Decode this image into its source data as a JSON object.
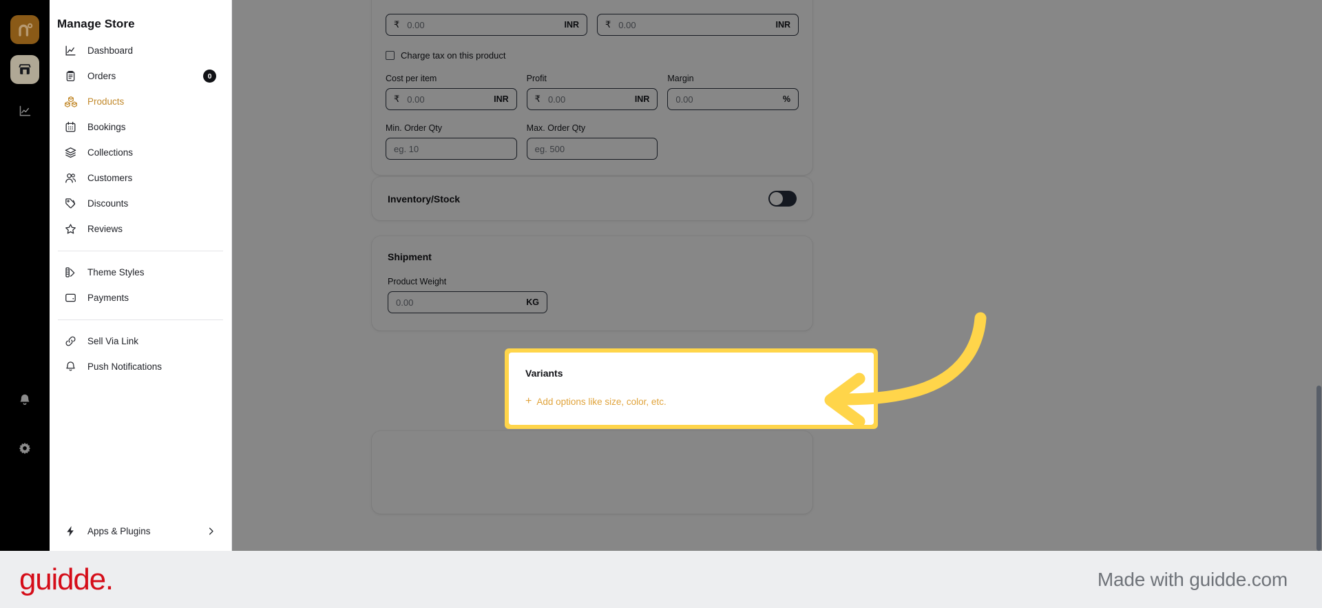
{
  "sidebar": {
    "title": "Manage Store",
    "items": [
      {
        "label": "Dashboard",
        "icon": "chart-line-icon",
        "active": false,
        "badge": null
      },
      {
        "label": "Orders",
        "icon": "clipboard-icon",
        "active": false,
        "badge": "0"
      },
      {
        "label": "Products",
        "icon": "boxes-icon",
        "active": true,
        "badge": null
      },
      {
        "label": "Bookings",
        "icon": "calendar-icon",
        "active": false,
        "badge": null
      },
      {
        "label": "Collections",
        "icon": "layers-icon",
        "active": false,
        "badge": null
      },
      {
        "label": "Customers",
        "icon": "users-icon",
        "active": false,
        "badge": null
      },
      {
        "label": "Discounts",
        "icon": "tags-icon",
        "active": false,
        "badge": null
      },
      {
        "label": "Reviews",
        "icon": "star-icon",
        "active": false,
        "badge": null
      }
    ],
    "group2": [
      {
        "label": "Theme Styles",
        "icon": "palette-icon"
      },
      {
        "label": "Payments",
        "icon": "wallet-icon"
      }
    ],
    "group3": [
      {
        "label": "Sell Via Link",
        "icon": "link-icon"
      },
      {
        "label": "Push Notifications",
        "icon": "bell-icon"
      }
    ],
    "bottom": {
      "label": "Apps & Plugins",
      "icon": "bolt-icon",
      "chevron": "chevron-right-icon"
    }
  },
  "rail": {
    "logo_label": "n",
    "items": [
      {
        "icon": "store-icon",
        "active": true
      },
      {
        "icon": "analytics-icon",
        "active": false
      }
    ],
    "bottom": [
      {
        "icon": "bell-icon"
      },
      {
        "icon": "gear-icon"
      }
    ]
  },
  "pricing": {
    "price_field": {
      "currency_symbol": "₹",
      "value": "0.00",
      "suffix": "INR"
    },
    "compare_field": {
      "currency_symbol": "₹",
      "value": "0.00",
      "suffix": "INR"
    },
    "charge_tax_label": "Charge tax on this product",
    "charge_tax_checked": false,
    "cost_label": "Cost per item",
    "cost_field": {
      "currency_symbol": "₹",
      "value": "0.00",
      "suffix": "INR"
    },
    "profit_label": "Profit",
    "profit_field": {
      "currency_symbol": "₹",
      "value": "0.00",
      "suffix": "INR"
    },
    "margin_label": "Margin",
    "margin_field": {
      "value": "0.00",
      "suffix": "%"
    },
    "min_qty_label": "Min. Order Qty",
    "min_qty_placeholder": "eg. 10",
    "max_qty_label": "Max. Order Qty",
    "max_qty_placeholder": "eg. 500"
  },
  "inventory": {
    "title": "Inventory/Stock",
    "enabled": false
  },
  "shipment": {
    "title": "Shipment",
    "weight_label": "Product Weight",
    "weight_value": "0.00",
    "weight_unit": "KG"
  },
  "variants": {
    "title": "Variants",
    "add_label": "Add options like size, color, etc.",
    "add_plus": "+",
    "highlight_color": "#ffd54a",
    "link_color": "#e0a33b"
  },
  "footer": {
    "logo": "guidde.",
    "made_with": "Made with guidde.com",
    "logo_color": "#d50d19"
  }
}
